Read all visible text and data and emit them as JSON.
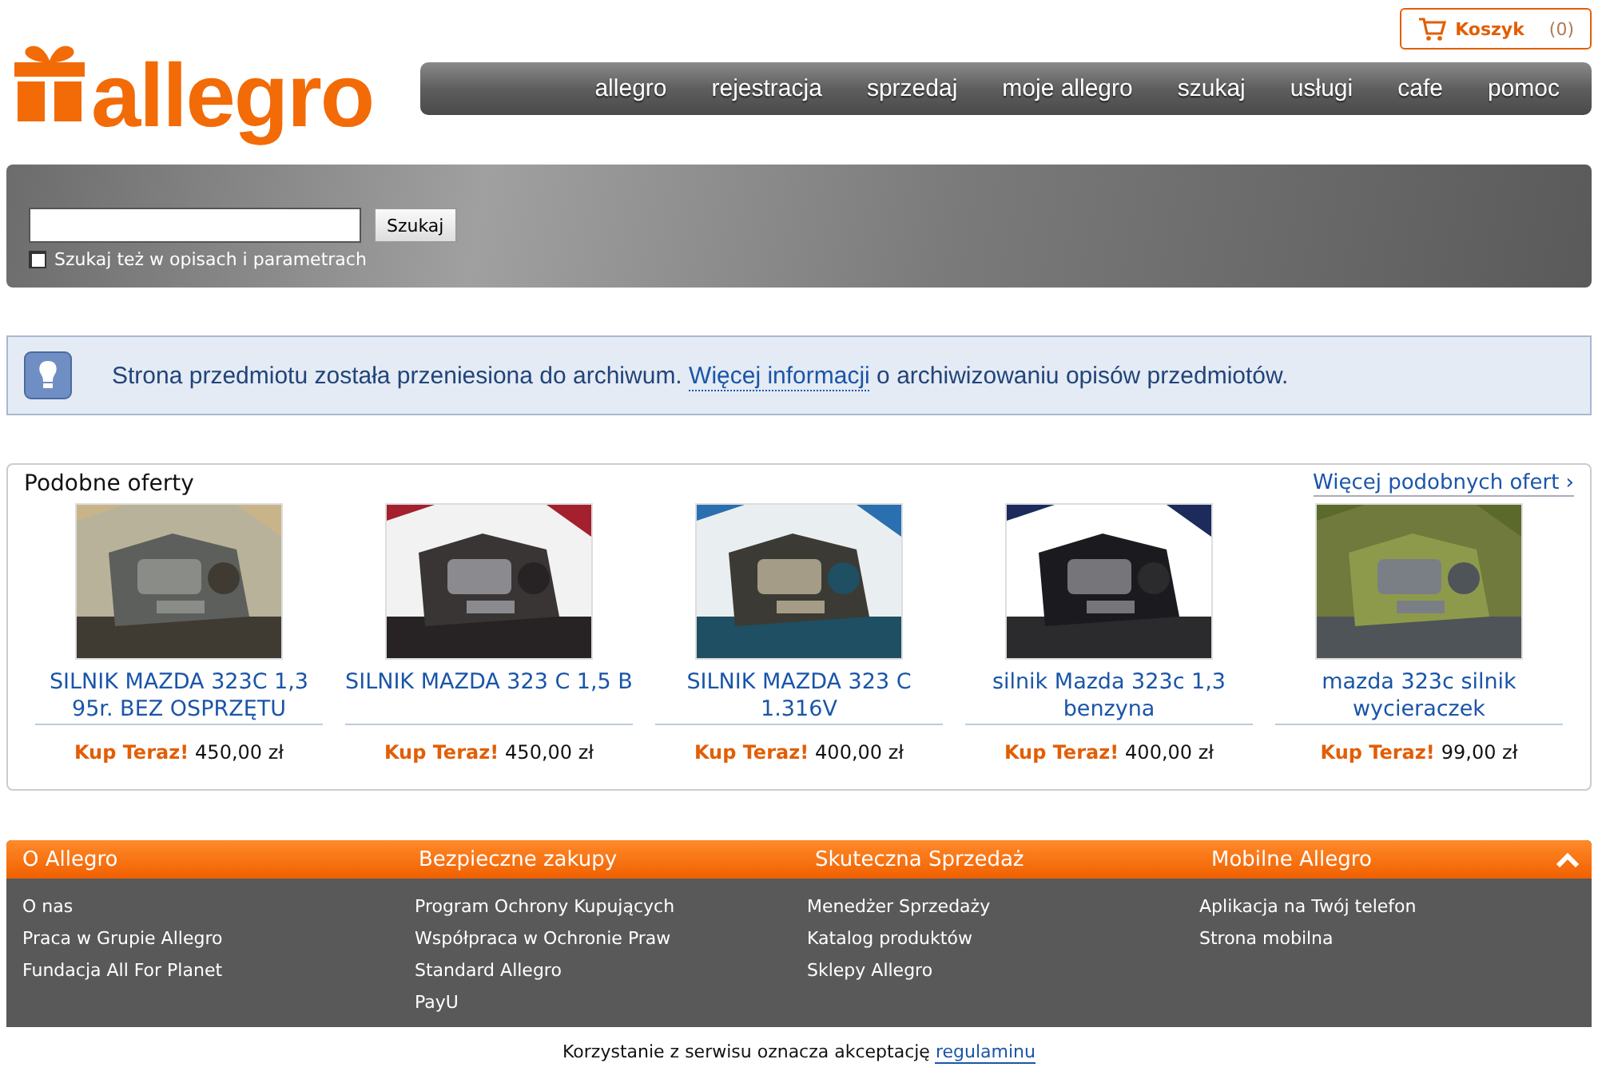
{
  "cart": {
    "label": "Koszyk",
    "count": "(0)"
  },
  "logo": {
    "text": "allegro"
  },
  "nav": [
    "allegro",
    "rejestracja",
    "sprzedaj",
    "moje allegro",
    "szukaj",
    "usługi",
    "cafe",
    "pomoc"
  ],
  "search": {
    "button": "Szukaj",
    "checkbox": {
      "label": "Szukaj też w opisach i parametrach",
      "checked": false
    }
  },
  "notice": {
    "before": "Strona przedmiotu została przeniesiona do archiwum.",
    "link": "Więcej informacji",
    "after": "o archiwizowaniu opisów przedmiotów."
  },
  "similar": {
    "title": "Podobne oferty",
    "more": "Więcej podobnych ofert ›",
    "items": [
      {
        "title": "SILNIK MAZDA 323C 1,3 95r. BEZ OSPRZĘTU",
        "buy": "Kup Teraz!",
        "price": "450,00 zł",
        "kind": "picture"
      },
      {
        "title": "SILNIK MAZDA 323 C 1,5 B",
        "buy": "Kup Teraz!",
        "price": "450,00 zł",
        "kind": "picture"
      },
      {
        "title": "SILNIK MAZDA 323 C 1.316V",
        "buy": "Kup Teraz!",
        "price": "400,00 zł",
        "kind": "picture"
      },
      {
        "title": "silnik Mazda 323c 1,3 benzyna",
        "buy": "Kup Teraz!",
        "price": "400,00 zł",
        "kind": "picture"
      },
      {
        "title": "mazda 323c silnik wycieraczek",
        "buy": "Kup Teraz!",
        "price": "99,00 zł",
        "kind": "picture"
      }
    ]
  },
  "footer": {
    "columns": [
      {
        "title": "O Allegro",
        "links": [
          "O nas",
          "Praca w Grupie Allegro",
          "Fundacja All For Planet"
        ]
      },
      {
        "title": "Bezpieczne zakupy",
        "links": [
          "Program Ochrony Kupujących",
          "Współpraca w Ochronie Praw",
          "Standard Allegro",
          "PayU"
        ]
      },
      {
        "title": "Skuteczna Sprzedaż",
        "links": [
          "Menedżer Sprzedaży",
          "Katalog produktów",
          "Sklepy Allegro"
        ]
      },
      {
        "title": "Mobilne Allegro",
        "links": [
          "Aplikacja na Twój telefon",
          "Strona mobilna"
        ]
      }
    ],
    "note": "Korzystanie z serwisu oznacza akceptację",
    "note_link": "regulaminu"
  }
}
